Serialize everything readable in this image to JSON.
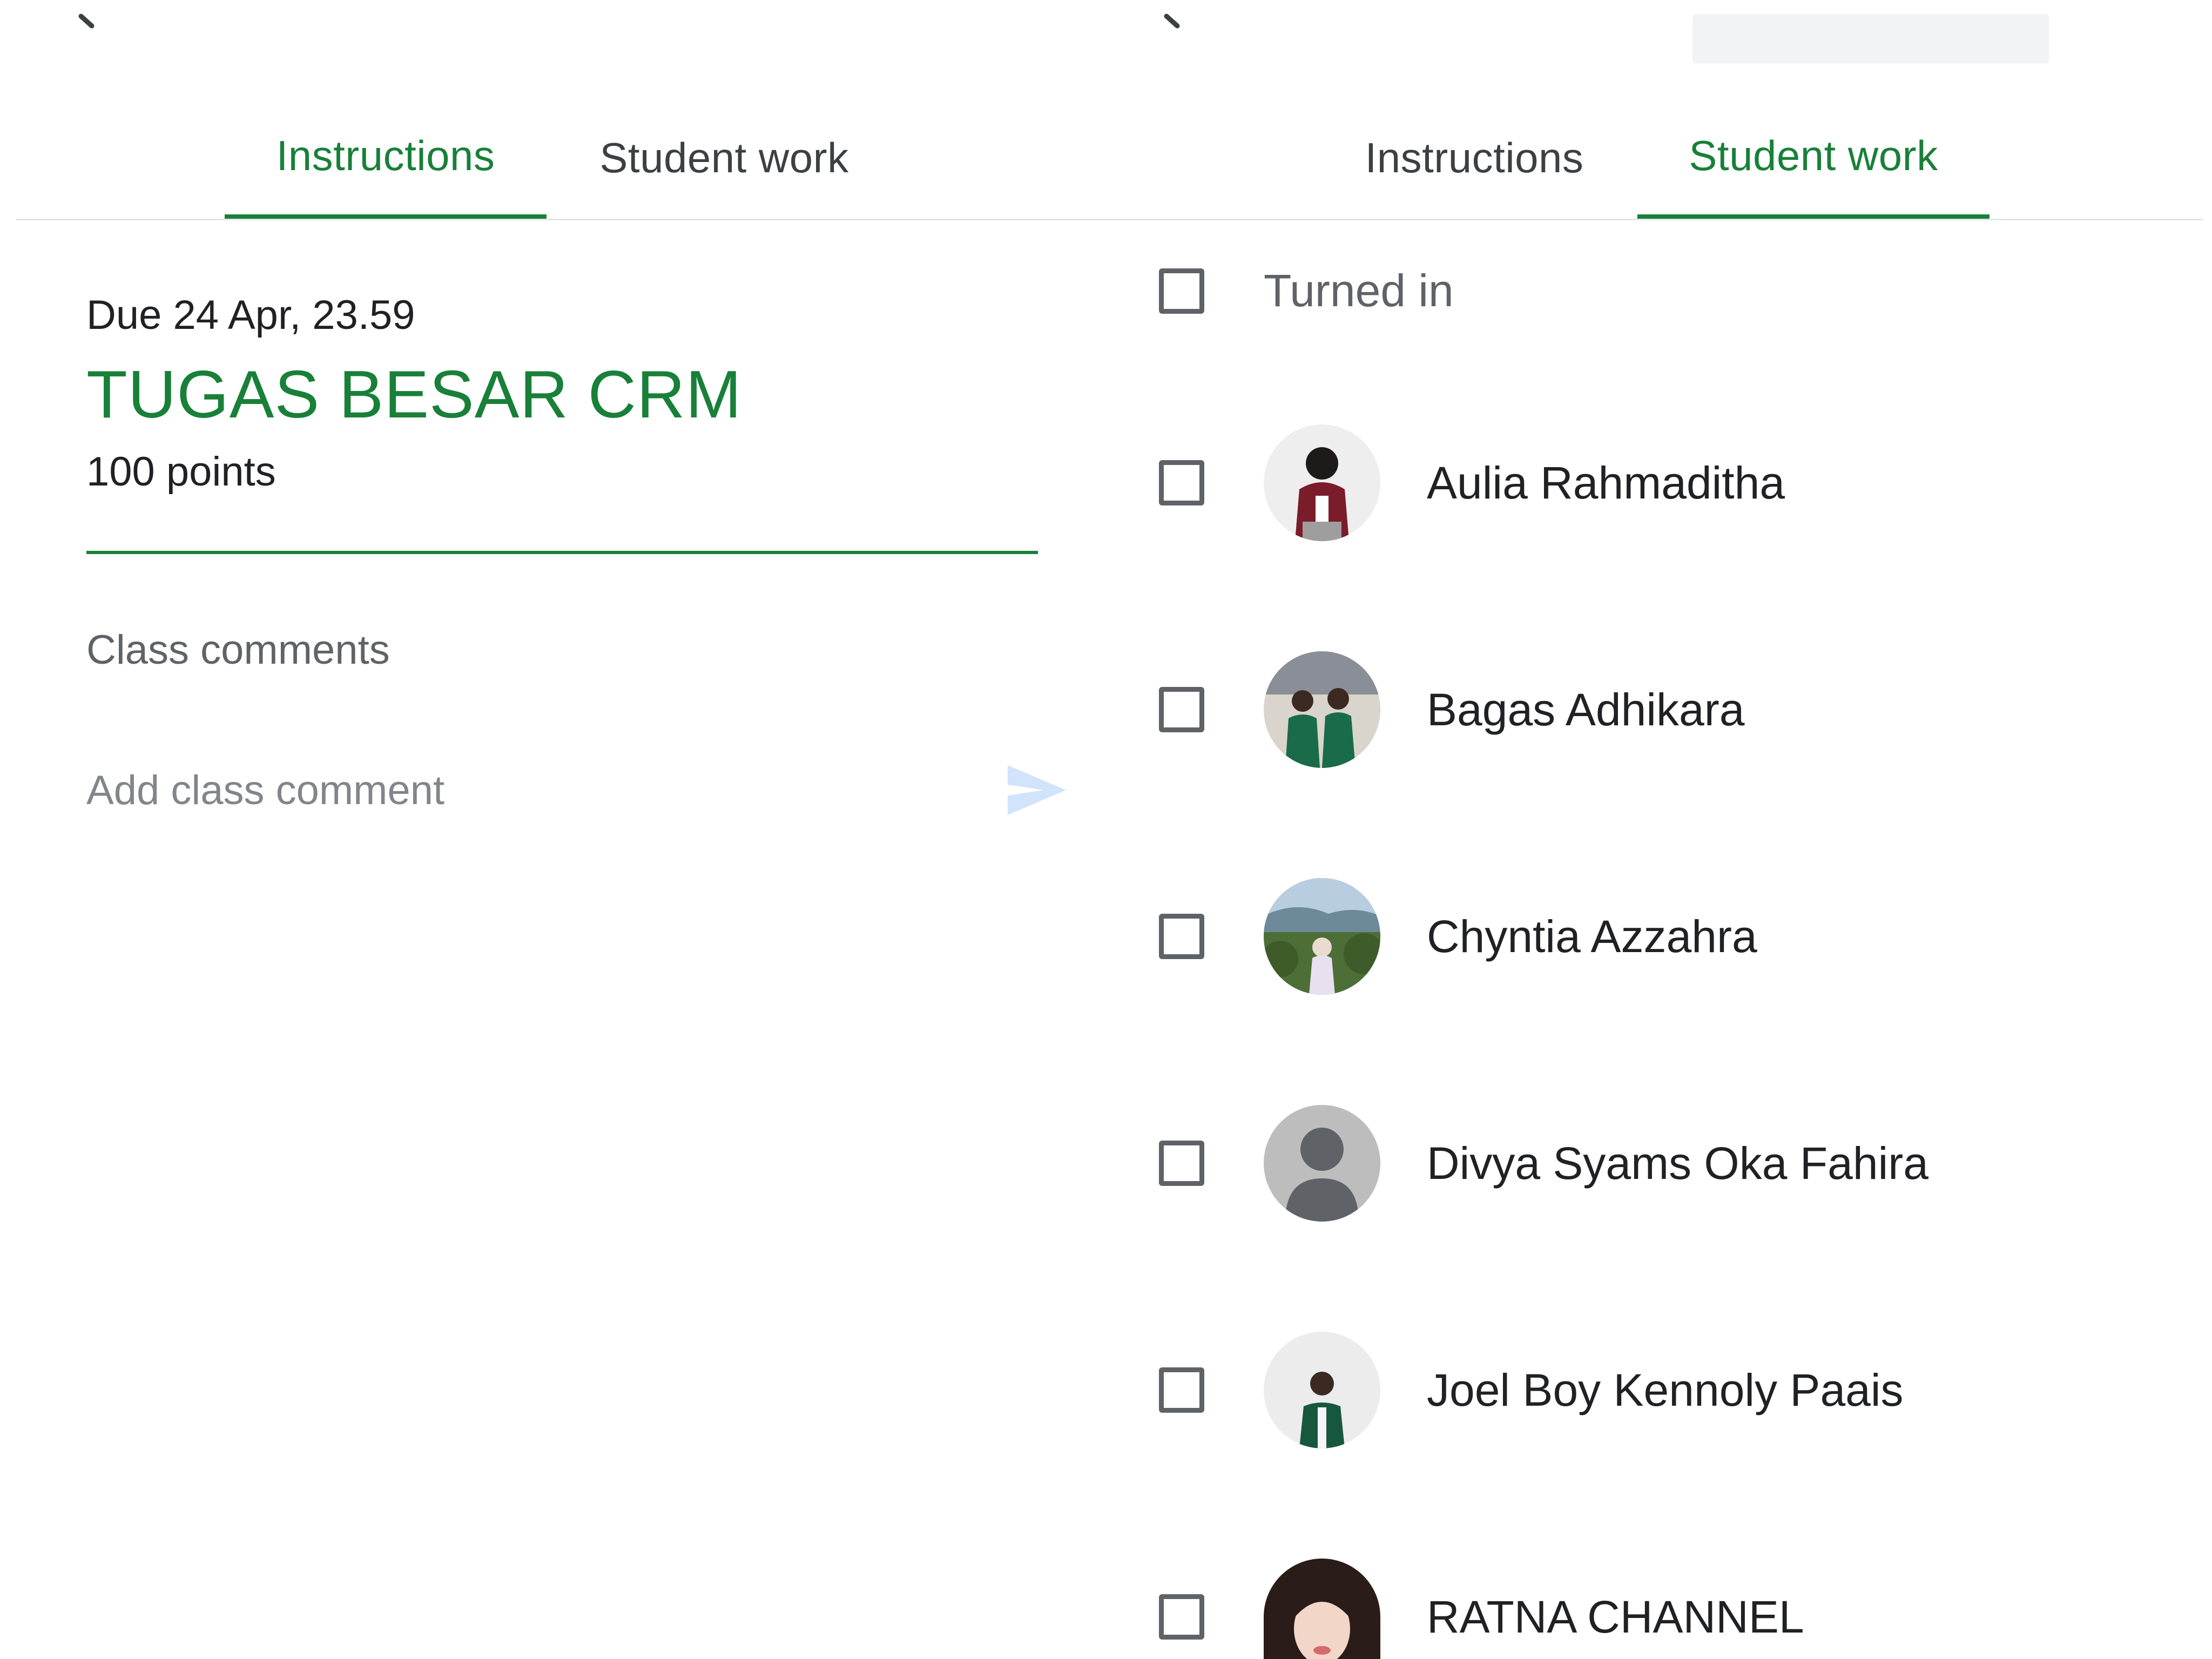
{
  "left_panel": {
    "tabs": [
      {
        "label": "Instructions",
        "active": true
      },
      {
        "label": "Student work",
        "active": false
      }
    ],
    "due": "Due 24 Apr, 23.59",
    "title": "TUGAS BESAR CRM",
    "points": "100 points",
    "class_comments_heading": "Class comments",
    "comment_placeholder": "Add class comment"
  },
  "right_panel": {
    "tabs": [
      {
        "label": "Instructions",
        "active": false
      },
      {
        "label": "Student work",
        "active": true
      }
    ],
    "turned_in_label": "Turned in",
    "students": [
      {
        "name": "Aulia Rahmaditha",
        "avatar": "photo"
      },
      {
        "name": "Bagas Adhikara",
        "avatar": "photo"
      },
      {
        "name": "Chyntia Azzahra",
        "avatar": "photo"
      },
      {
        "name": "Divya Syams Oka Fahira",
        "avatar": "default-person-icon"
      },
      {
        "name": "Joel Boy Kennoly Paais",
        "avatar": "photo"
      },
      {
        "name": "RATNA CHANNEL",
        "avatar": "photo"
      }
    ]
  },
  "colors": {
    "accent": "#188038",
    "send_icon": "#d2e3fc",
    "muted_text": "#5f6368"
  }
}
